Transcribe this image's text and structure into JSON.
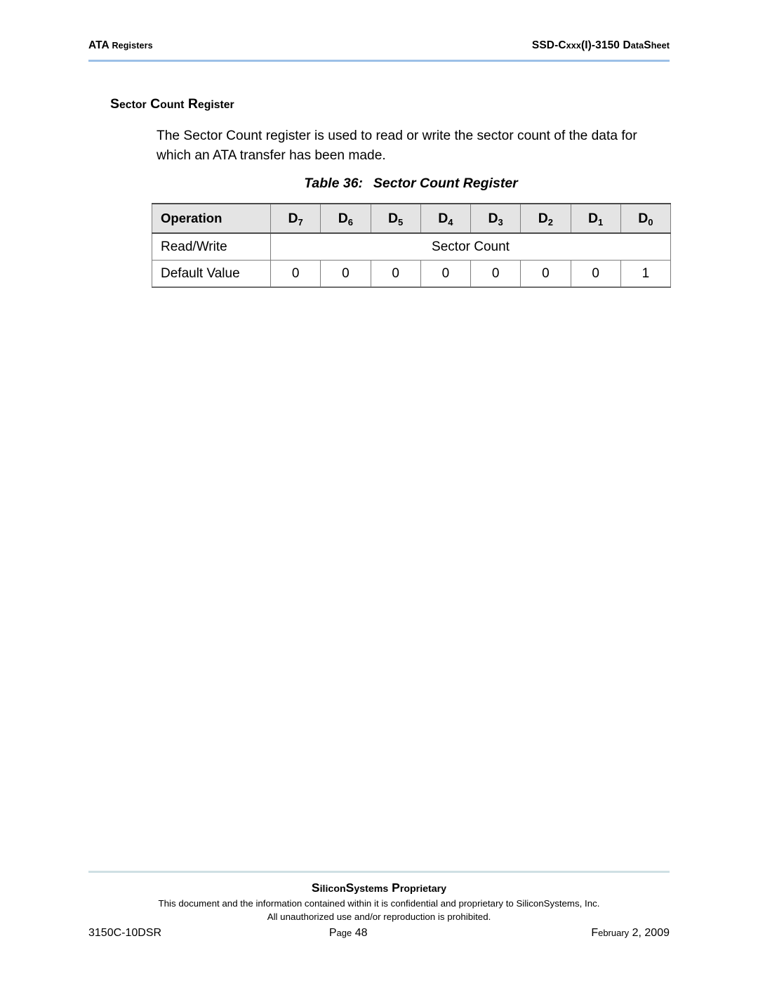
{
  "header": {
    "left_lead": "ATA",
    "left_rest": " Registers",
    "right_lead": "SSD-C",
    "right_mid": "xxx",
    "right_paren": "(I)-3150 ",
    "right_d": "D",
    "right_ata": "ata",
    "right_s": "S",
    "right_heet": "heet",
    "rule_color": "#9cc0e7"
  },
  "section": {
    "title_s": "S",
    "title_ector": "ector",
    "title_c": "C",
    "title_ount": "ount",
    "title_r": "R",
    "title_egister": "egister"
  },
  "body": {
    "paragraph": "The Sector Count register is used to read or write the sector count of the data for which an ATA transfer has been made."
  },
  "table": {
    "caption_label": "Table 36:",
    "caption_title": "Sector Count Register",
    "header_fill": "#e4e4e4",
    "columns": [
      {
        "label": "Operation",
        "sub": ""
      },
      {
        "label": "D",
        "sub": "7"
      },
      {
        "label": "D",
        "sub": "6"
      },
      {
        "label": "D",
        "sub": "5"
      },
      {
        "label": "D",
        "sub": "4"
      },
      {
        "label": "D",
        "sub": "3"
      },
      {
        "label": "D",
        "sub": "2"
      },
      {
        "label": "D",
        "sub": "1"
      },
      {
        "label": "D",
        "sub": "0"
      }
    ],
    "rows": [
      {
        "label": "Read/Write",
        "merged": true,
        "merged_value": "Sector Count",
        "values": []
      },
      {
        "label": "Default Value",
        "merged": false,
        "merged_value": "",
        "values": [
          "0",
          "0",
          "0",
          "0",
          "0",
          "0",
          "0",
          "1"
        ]
      }
    ]
  },
  "footer": {
    "rule_color": "#cfe0e4",
    "prop_s1": "S",
    "prop_ilicon": "ilicon",
    "prop_s2": "S",
    "prop_ystems": "ystems",
    "prop_p": "P",
    "prop_roprietary": "roprietary",
    "legal_line1": "This document and the information contained within it is confidential and proprietary to SiliconSystems, Inc.",
    "legal_line2": "All unauthorized use and/or reproduction is prohibited.",
    "doc_code": "3150C-10DSR",
    "page_p": "P",
    "page_age": "age",
    "page_number": " 48",
    "date_f": "F",
    "date_ebruary": "ebruary",
    "date_rest": " 2, 2009"
  }
}
